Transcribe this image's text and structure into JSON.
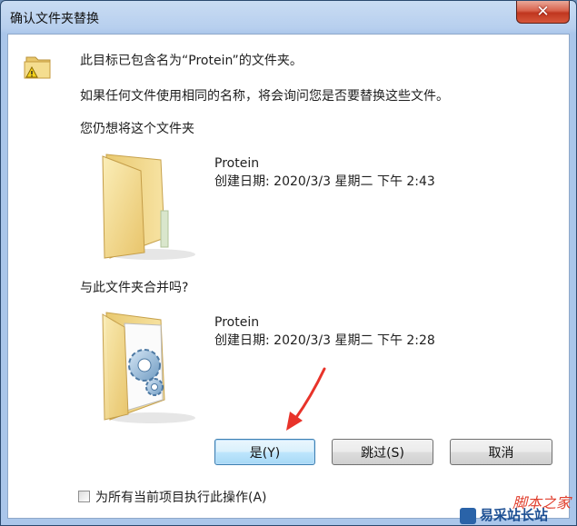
{
  "window": {
    "title": "确认文件夹替换",
    "close_glyph": "✕"
  },
  "dialog": {
    "message1": "此目标已包含名为“Protein”的文件夹。",
    "message2": "如果任何文件使用相同的名称，将会询问您是否要替换这些文件。",
    "prompt1": "您仍想将这个文件夹",
    "prompt2": "与此文件夹合并吗?",
    "folder_existing": {
      "name": "Protein",
      "created": "创建日期: 2020/3/3 星期二 下午 2:43",
      "icon": "folder-icon"
    },
    "folder_new": {
      "name": "Protein",
      "created": "创建日期: 2020/3/3 星期二 下午 2:28",
      "icon": "folder-with-settings-icon"
    },
    "buttons": {
      "yes": "是(Y)",
      "skip": "跳过(S)",
      "cancel": "取消"
    },
    "checkbox_label": "为所有当前项目执行此操作(A)",
    "checkbox_checked": false
  },
  "annotation": {
    "arrow_color": "#e8332a"
  },
  "watermark": {
    "text1": "脚本之家",
    "text2": "易采站长站"
  }
}
